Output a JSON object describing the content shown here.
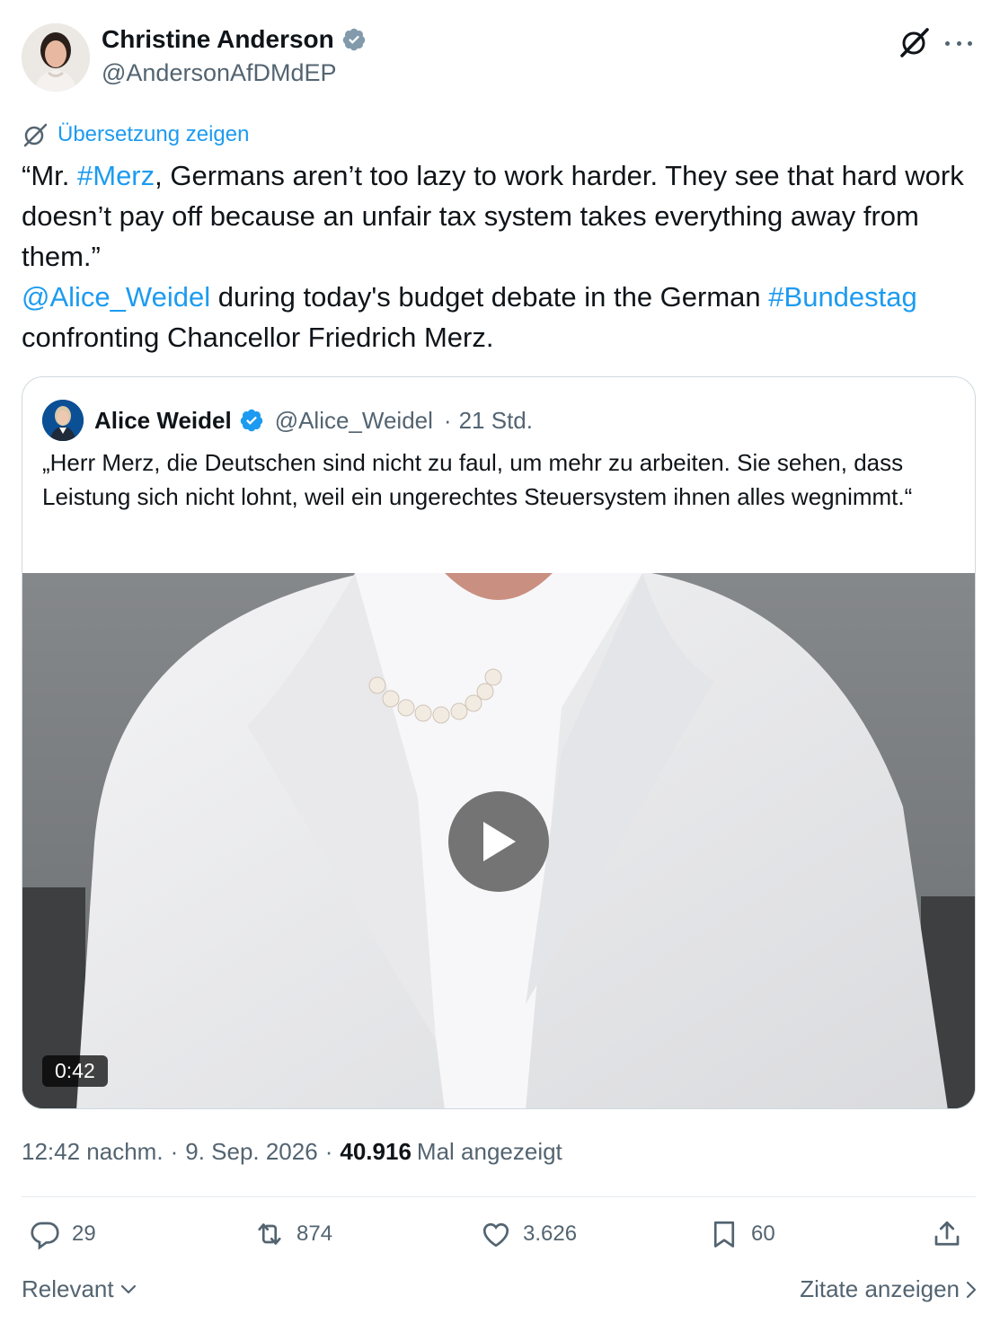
{
  "author": {
    "name": "Christine Anderson",
    "handle": "@AndersonAfDMdEP",
    "verified_color": "#829aab"
  },
  "translate_label": "Übersetzung zeigen",
  "tweet": {
    "line1_pre": "“Mr. ",
    "hashtag_merz": "#Merz",
    "line1_post": ", Germans aren’t too lazy to work harder. They see that hard work doesn’t pay off because an unfair tax system takes everything away from them.”",
    "mention": "@Alice_Weidel",
    "mid": " during today's budget debate in the German ",
    "hashtag_bundestag": "#Bundestag",
    "end": " confronting Chancellor Friedrich Merz."
  },
  "quote": {
    "name": "Alice Weidel",
    "handle": "@Alice_Weidel",
    "separator": "·",
    "time": "21 Std.",
    "text": "„Herr Merz, die Deutschen sind nicht zu faul, um mehr zu arbeiten. Sie sehen, dass Leistung sich nicht lohnt, weil ein ungerechtes Steuersystem ihnen alles wegnimmt.“",
    "video_duration": "0:42"
  },
  "meta": {
    "time": "12:42 nachm.",
    "dot": "·",
    "date": "9. Sep. 2026",
    "views_count": "40.916",
    "views_label": "Mal angezeigt"
  },
  "actions": {
    "replies": "29",
    "reposts": "874",
    "likes": "3.626",
    "bookmarks": "60"
  },
  "footer": {
    "sort_label": "Relevant",
    "quotes_label": "Zitate anzeigen"
  },
  "colors": {
    "link": "#1d9bf0",
    "secondary_text": "#536471",
    "verified_blue": "#1d9bf0"
  }
}
